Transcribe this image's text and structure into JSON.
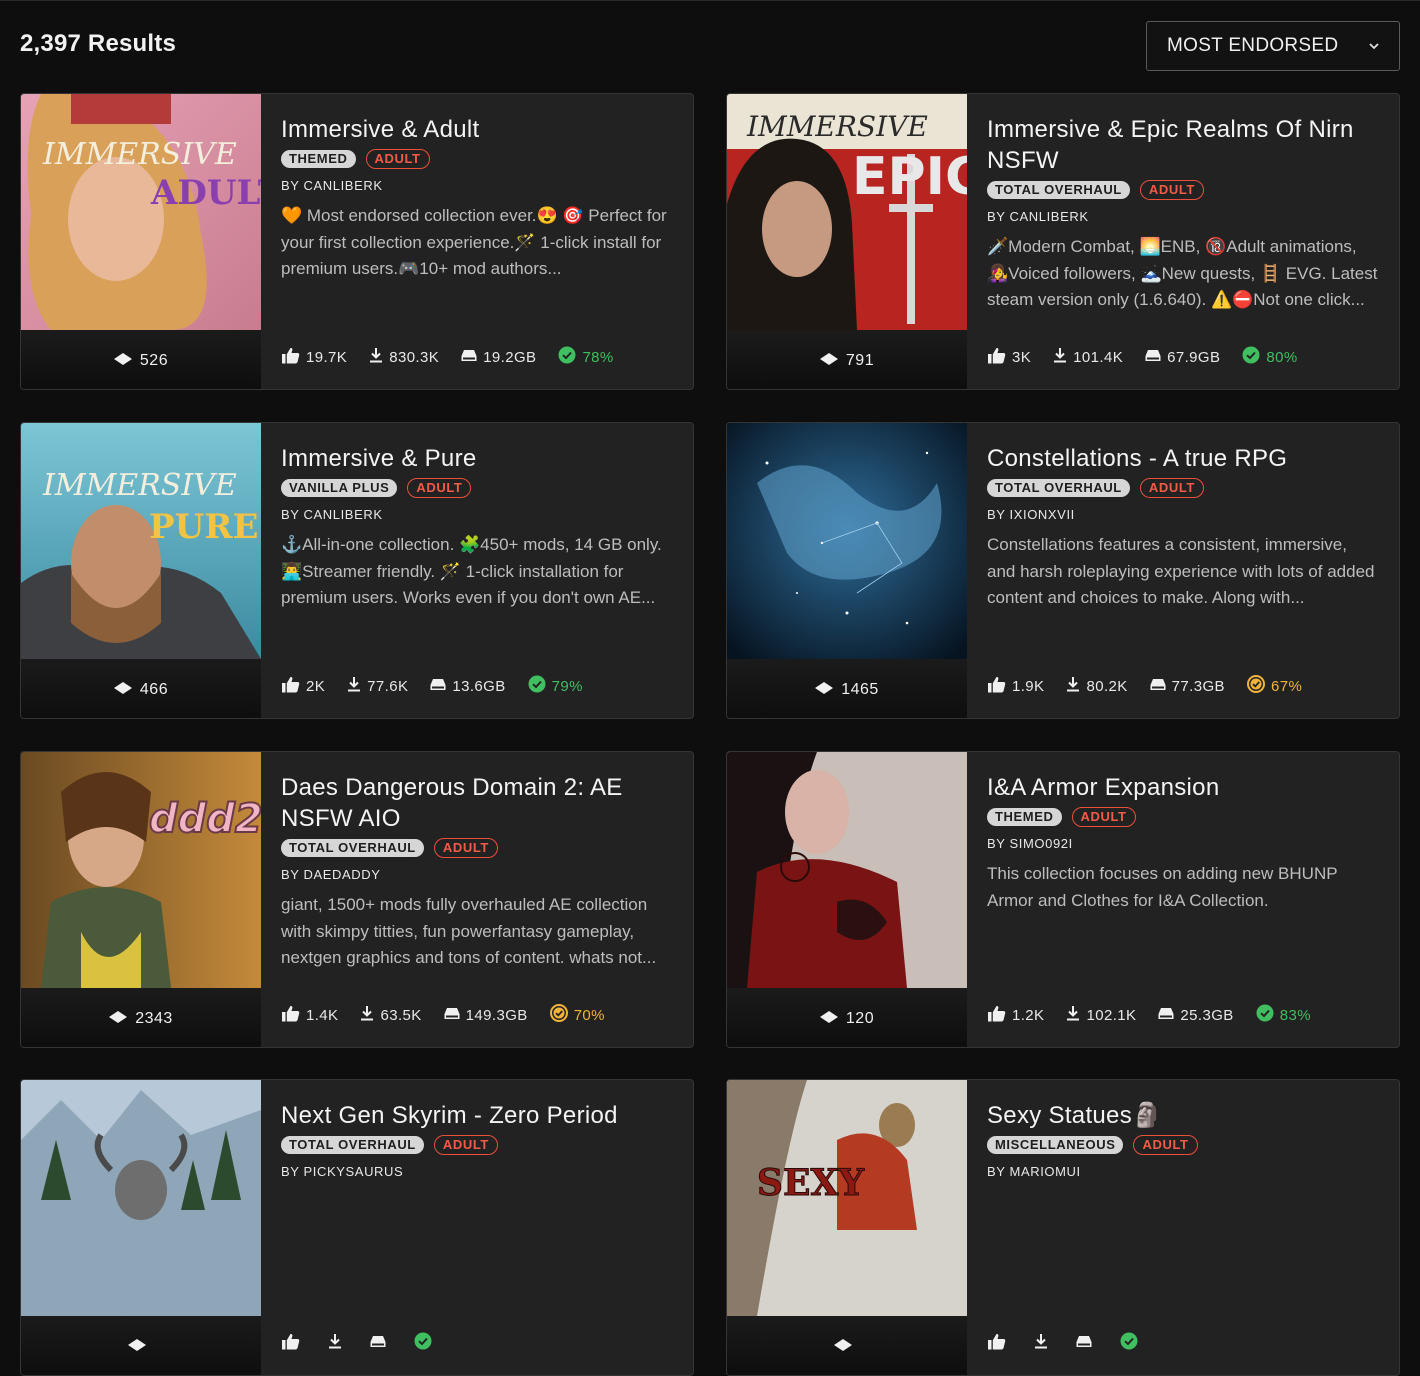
{
  "results_label": "2,397 Results",
  "sort": {
    "selected": "MOST ENDORSED"
  },
  "colors": {
    "adult_tag": "#f25b45",
    "success_green": "#3fbf5f",
    "warning_yellow": "#f1b43a"
  },
  "cards": [
    {
      "title": "Immersive & Adult",
      "category": "THEMED",
      "adult": "ADULT",
      "author": "BY CANLIBERK",
      "description": "🧡 Most endorsed collection ever.😍 🎯 Perfect for your first collection experience.🪄 1-click install for premium users.🎮10+ mod authors...",
      "endorsements": "526",
      "likes": "19.7K",
      "downloads": "830.3K",
      "size": "19.2GB",
      "success": "78%",
      "success_level": "green",
      "thumb_text": "IMMERSIVE & ADULT"
    },
    {
      "title": "Immersive & Epic Realms Of Nirn NSFW",
      "category": "TOTAL OVERHAUL",
      "adult": "ADULT",
      "author": "BY CANLIBERK",
      "description": "🗡️Modern Combat, 🌅ENB, 🔞Adult animations, 👩‍🎤Voiced followers, 🗻New quests, 🪜 EVG. Latest steam version only (1.6.640). ⚠️⛔Not one click...",
      "endorsements": "791",
      "likes": "3K",
      "downloads": "101.4K",
      "size": "67.9GB",
      "success": "80%",
      "success_level": "green",
      "thumb_text": "IMMERSIVE EPIC"
    },
    {
      "title": "Immersive & Pure",
      "category": "VANILLA PLUS",
      "adult": "ADULT",
      "author": "BY CANLIBERK",
      "description": "⚓All-in-one collection. 🧩450+ mods, 14 GB only. 👨‍💻Streamer friendly. 🪄 1-click installation for premium users. Works even if you don't own AE...",
      "endorsements": "466",
      "likes": "2K",
      "downloads": "77.6K",
      "size": "13.6GB",
      "success": "79%",
      "success_level": "green",
      "thumb_text": "IMMERSIVE & PURE"
    },
    {
      "title": "Constellations - A true RPG",
      "category": "TOTAL OVERHAUL",
      "adult": "ADULT",
      "author": "BY IXIONXVII",
      "description": "Constellations features a consistent, immersive, and harsh roleplaying experience with lots of added content and choices to make. Along with...",
      "endorsements": "1465",
      "likes": "1.9K",
      "downloads": "80.2K",
      "size": "77.3GB",
      "success": "67%",
      "success_level": "yellow",
      "thumb_text": ""
    },
    {
      "title": "Daes Dangerous Domain 2: AE NSFW AIO",
      "category": "TOTAL OVERHAUL",
      "adult": "ADULT",
      "author": "BY DAEDADDY",
      "description": "giant, 1500+ mods fully overhauled AE collection with skimpy titties, fun powerfantasy gameplay, nextgen graphics and tons of content. whats not...",
      "endorsements": "2343",
      "likes": "1.4K",
      "downloads": "63.5K",
      "size": "149.3GB",
      "success": "70%",
      "success_level": "yellow",
      "thumb_text": "ddd2"
    },
    {
      "title": "I&A Armor Expansion",
      "category": "THEMED",
      "adult": "ADULT",
      "author": "BY SIMO092I",
      "description": "This collection focuses on adding new BHUNP Armor and Clothes for I&A Collection.",
      "endorsements": "120",
      "likes": "1.2K",
      "downloads": "102.1K",
      "size": "25.3GB",
      "success": "83%",
      "success_level": "green",
      "thumb_text": ""
    },
    {
      "title": "Next Gen Skyrim - Zero Period",
      "category": "TOTAL OVERHAUL",
      "adult": "ADULT",
      "author": "BY PICKYSAURUS",
      "description": "",
      "endorsements": "",
      "likes": "",
      "downloads": "",
      "size": "",
      "success": "",
      "success_level": "green",
      "thumb_text": ""
    },
    {
      "title": "Sexy Statues🗿",
      "category": "MISCELLANEOUS",
      "adult": "ADULT",
      "author": "BY MARIOMUI",
      "description": "",
      "endorsements": "",
      "likes": "",
      "downloads": "",
      "size": "",
      "success": "",
      "success_level": "green",
      "thumb_text": "SEXY"
    }
  ]
}
